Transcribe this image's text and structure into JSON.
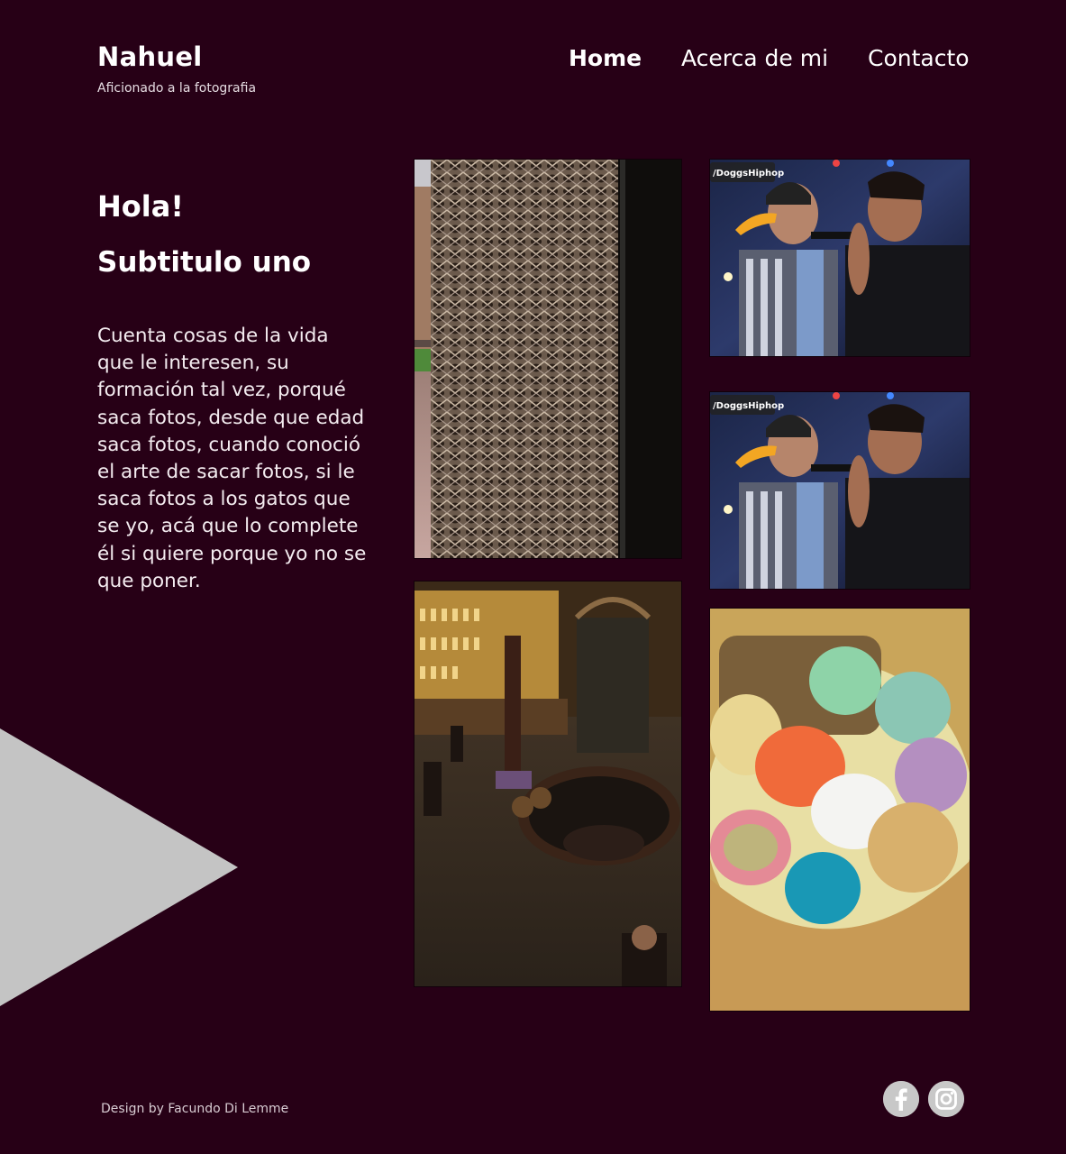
{
  "header": {
    "brand_name": "Nahuel",
    "tagline": "Aficionado a la fotografia",
    "nav": {
      "home": "Home",
      "about": "Acerca de mi",
      "contact": "Contacto"
    }
  },
  "main": {
    "title": "Hola!",
    "subtitle": "Subtitulo uno",
    "body": "Cuenta cosas de la vida que le interesen, su formación tal vez, porqué saca fotos, desde que edad saca fotos, cuando conoció el arte de sacar fotos, si le saca fotos a los gatos que se yo, acá que lo complete él si quiere porque yo no se que poner.",
    "photos": {
      "watermark": "/DoggsHiphop"
    }
  },
  "footer": {
    "credit": "Design by Facundo Di Lemme",
    "social_icons": [
      "facebook-icon",
      "instagram-icon"
    ]
  },
  "colors": {
    "background": "#270016",
    "text": "#ffffff",
    "triangle": "#c4c4c4",
    "social_icon_bg": "#c8c8c8"
  }
}
